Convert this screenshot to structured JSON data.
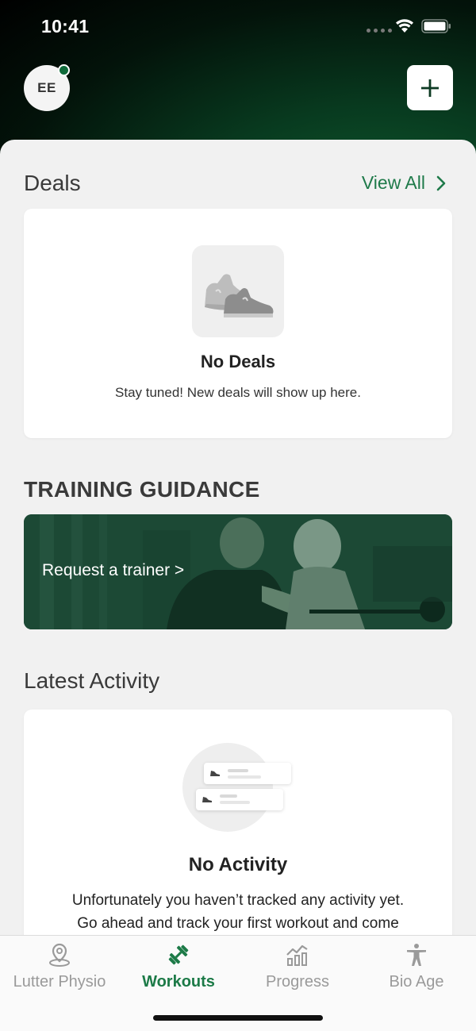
{
  "status": {
    "time": "10:41"
  },
  "header": {
    "avatar_initials": "EE",
    "add_button_label": "+"
  },
  "deals": {
    "title": "Deals",
    "view_all": "View All",
    "empty_title": "No Deals",
    "empty_subtitle": "Stay tuned! New deals will show up here."
  },
  "training": {
    "title": "TRAINING GUIDANCE",
    "cta": "Request a trainer >"
  },
  "activity": {
    "title": "Latest Activity",
    "empty_title": "No Activity",
    "empty_line1": "Unfortunately you haven’t tracked any activity yet.",
    "empty_line2": "Go ahead and track your first workout and come"
  },
  "tabs": [
    {
      "label": "Lutter Physio",
      "icon": "location-pin-icon",
      "active": false
    },
    {
      "label": "Workouts",
      "icon": "dumbbell-icon",
      "active": true
    },
    {
      "label": "Progress",
      "icon": "chart-icon",
      "active": false
    },
    {
      "label": "Bio Age",
      "icon": "person-icon",
      "active": false
    }
  ],
  "colors": {
    "accent": "#1c7a47",
    "header_dark": "#03130a",
    "header_green": "#0f5a2e"
  }
}
